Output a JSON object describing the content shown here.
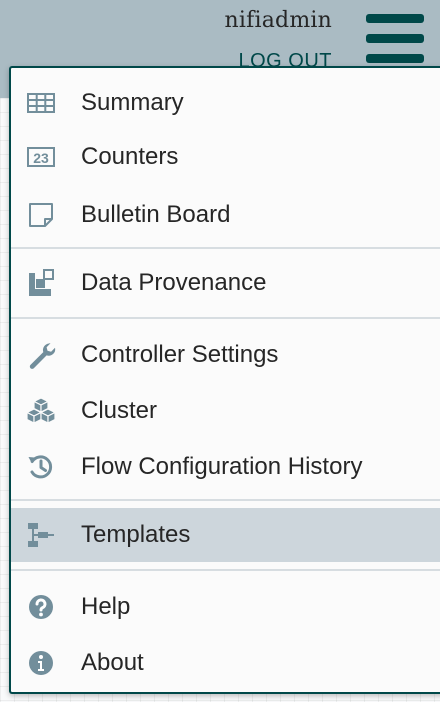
{
  "header": {
    "username": "nifiadmin",
    "logout_label": "LOG OUT"
  },
  "menu": {
    "items": [
      {
        "label": "Summary",
        "icon": "table-icon"
      },
      {
        "label": "Counters",
        "icon": "counter-icon"
      },
      {
        "label": "Bulletin Board",
        "icon": "sticky-note-icon"
      },
      {
        "label": "Data Provenance",
        "icon": "provenance-icon"
      },
      {
        "label": "Controller Settings",
        "icon": "wrench-icon"
      },
      {
        "label": "Cluster",
        "icon": "cubes-icon"
      },
      {
        "label": "Flow Configuration History",
        "icon": "history-icon"
      },
      {
        "label": "Templates",
        "icon": "template-icon",
        "selected": true
      },
      {
        "label": "Help",
        "icon": "question-circle-icon"
      },
      {
        "label": "About",
        "icon": "info-circle-icon"
      }
    ]
  },
  "colors": {
    "accent": "#004849",
    "icon": "#728e9b",
    "selected_bg": "#cdd6dc",
    "topbar": "#aabbc3"
  }
}
